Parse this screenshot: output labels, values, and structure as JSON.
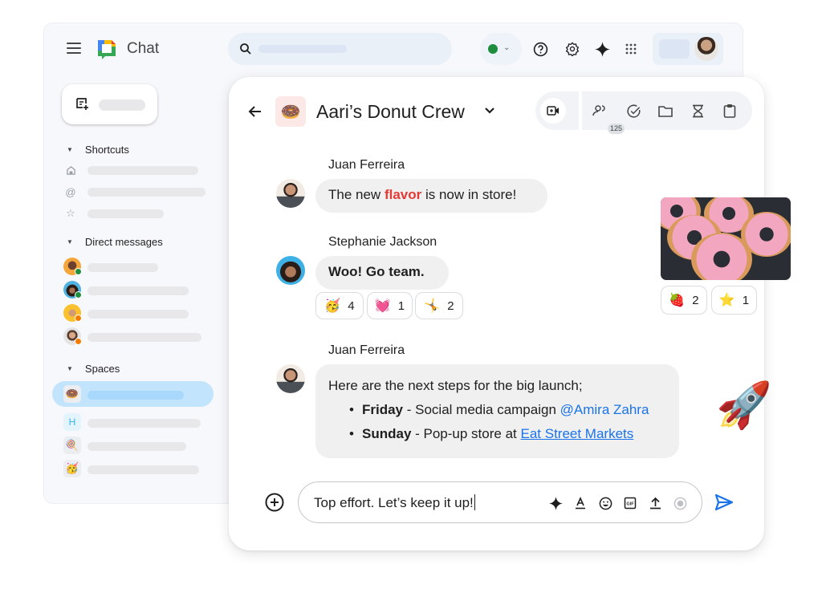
{
  "app": {
    "title": "Chat",
    "icons": {
      "menu": "hamburger-menu-icon",
      "logo": "google-chat-logo",
      "search": "search-icon",
      "help": "help-icon",
      "settings": "gear-icon",
      "gemini": "sparkle-icon",
      "apps": "apps-grid-icon"
    },
    "status": {
      "color": "#1e8e3e",
      "state": "active"
    }
  },
  "sidebar": {
    "new_chat_icon": "new-chat-icon",
    "sections": [
      {
        "label": "Shortcuts",
        "items": [
          {
            "icon": "home-icon"
          },
          {
            "icon": "mentions-icon"
          },
          {
            "icon": "star-icon"
          }
        ]
      },
      {
        "label": "Direct messages",
        "items": [
          {
            "presence": "online",
            "badge_color": "#1e8e3e"
          },
          {
            "presence": "online",
            "badge_color": "#1e8e3e"
          },
          {
            "presence": "away",
            "badge_color": "#f57c00"
          },
          {
            "presence": "away",
            "badge_color": "#f57c00"
          }
        ]
      },
      {
        "label": "Spaces",
        "items": [
          {
            "emoji": "🍩",
            "active": true
          },
          {
            "letter": "H"
          },
          {
            "emoji": "🍭"
          },
          {
            "emoji": "🥳"
          }
        ]
      }
    ]
  },
  "chat": {
    "space_emoji": "🍩",
    "space_name": "Aari’s Donut Crew",
    "member_count": "125",
    "header_icons": [
      "video-call-icon",
      "members-icon",
      "tasks-icon",
      "files-icon",
      "workflow-icon",
      "clipboard-icon"
    ],
    "messages": [
      {
        "sender": "Juan Ferreira",
        "text_before": "The new ",
        "highlight": "flavor",
        "text_after": " is now in store!"
      },
      {
        "sender": "Stephanie Jackson",
        "text": "Woo! Go team.",
        "reactions": [
          {
            "emoji": "🥳",
            "count": "4"
          },
          {
            "emoji": "💓",
            "count": "1"
          },
          {
            "emoji": "🤸",
            "count": "2"
          }
        ]
      },
      {
        "sender": "Juan Ferreira",
        "intro": "Here are the next steps for the big launch;",
        "bullets": [
          {
            "day": "Friday",
            "text": " - Social media campaign ",
            "mention": "@Amira Zahra"
          },
          {
            "day": "Sunday",
            "text": " - Pop-up store at ",
            "link": "Eat Street Markets"
          }
        ]
      }
    ],
    "image_reactions": [
      {
        "emoji": "🍓",
        "count": "2"
      },
      {
        "emoji": "⭐",
        "count": "1"
      }
    ],
    "sticker": "🚀",
    "composer": {
      "value": "Top effort. Let’s keep it up!",
      "icons": [
        "gemini-sparkle-icon",
        "format-text-icon",
        "emoji-icon",
        "gif-icon",
        "upload-icon",
        "record-icon"
      ]
    }
  }
}
